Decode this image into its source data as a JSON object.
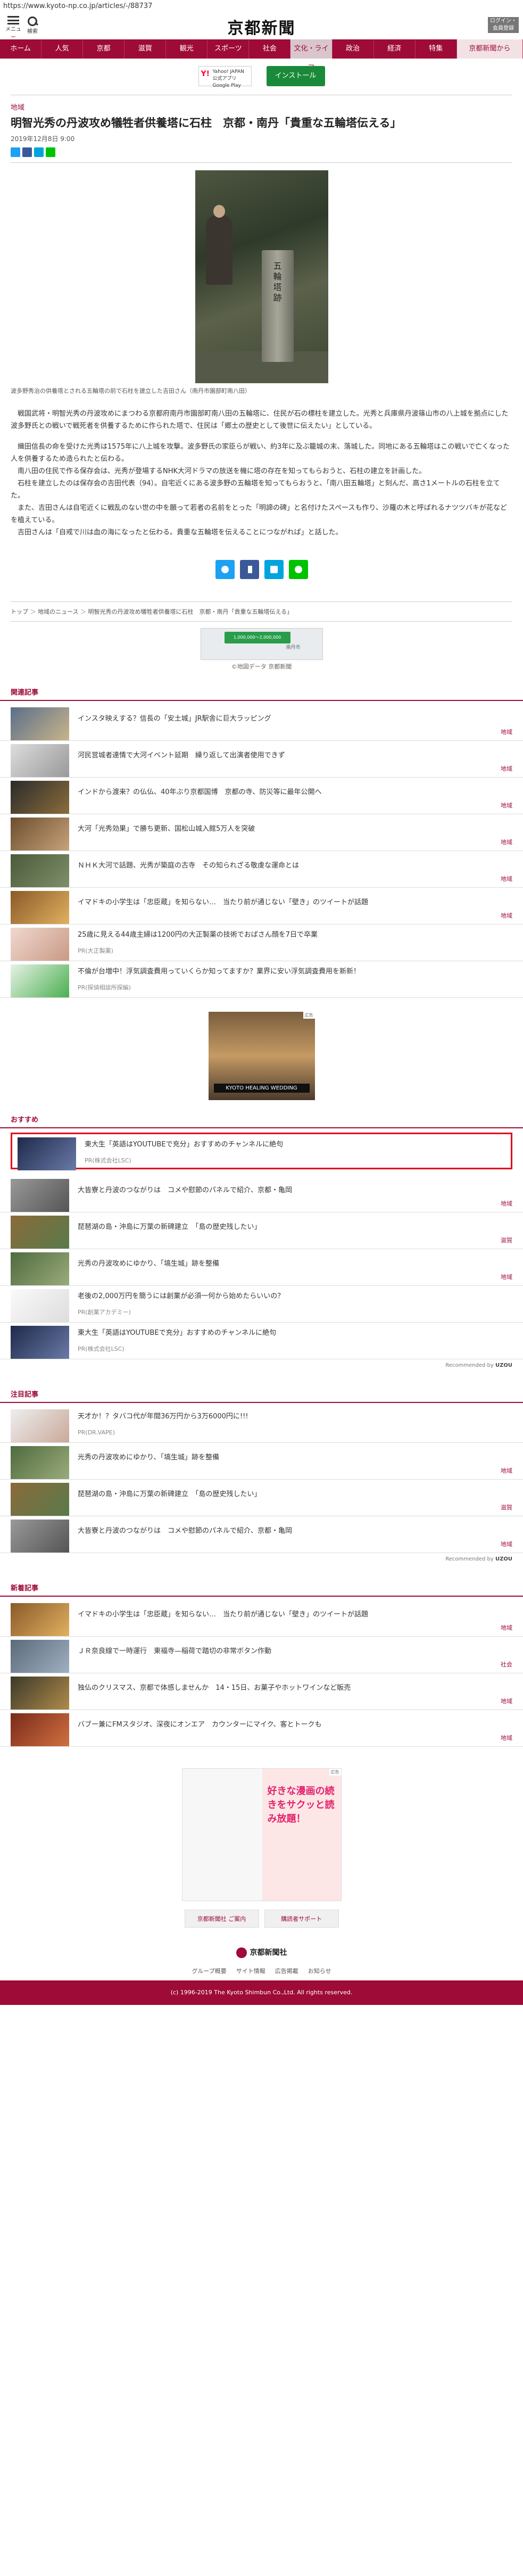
{
  "url": "https://www.kyoto-np.co.jp/articles/-/88737",
  "header": {
    "menu_label": "メニュー",
    "search_label": "検索",
    "logo": "京都新聞",
    "login_label": "ログイン・会員登録"
  },
  "nav": [
    {
      "label": "ホーム"
    },
    {
      "label": "人気"
    },
    {
      "label": "京都"
    },
    {
      "label": "滋賀"
    },
    {
      "label": "観光"
    },
    {
      "label": "スポーツ"
    },
    {
      "label": "社会"
    },
    {
      "label": "文化・ライフ"
    },
    {
      "label": "政治"
    },
    {
      "label": "経済"
    },
    {
      "label": "特集"
    },
    {
      "label": "京都新聞から"
    }
  ],
  "promo": {
    "app_text": "Yahoo! JAPAN 公式アプリ Google Play",
    "install_label": "インストール"
  },
  "article": {
    "kicker": "地域",
    "headline": "明智光秀の丹波攻め犠牲者供養塔に石柱　京都・南丹「貴重な五輪塔伝える」",
    "date": "2019年12月8日 9:00",
    "photo_inscription": "五輪塔跡",
    "caption": "波多野秀治の供養塔とされる五輪塔の前で石柱を建立した吉田さん（南丹市園部町南八田）",
    "paragraphs": [
      "戦国武将・明智光秀の丹波攻めにまつわる京都府南丹市園部町南八田の五輪塔に、住民が石の標柱を建立した。光秀と兵庫県丹波篠山市の八上城を拠点にした波多野氏との戦いで戦死者を供養するために作られた塔で、住民は「郷土の歴史として後世に伝えたい」としている。",
      "織田信長の命を受けた光秀は1575年に八上城を攻撃。波多野氏の家臣らが戦い、約3年に及ぶ籠城の末、落城した。同地にある五輪塔はこの戦いで亡くなった人を供養するため造られたと伝わる。",
      "南八田の住民で作る保存会は、光秀が登場するNHK大河ドラマの放送を機に塔の存在を知ってもらおうと、石柱の建立を計画した。",
      "石柱を建立したのは保存会の吉田代表（94）。自宅近くにある波多野の五輪塔を知ってもらおうと、「南八田五輪塔」と刻んだ、高さ1メートルの石柱を立てた。",
      "また、吉田さんは自宅近くに戦乱のない世の中を願って若者の名前をとった「明諦の碑」と名付けたスペースも作り、沙羅の木と呼ばれるナツツバキが花などを植えている。",
      "吉田さんは「自戒で川は血の海になったと伝わる。貴重な五輪塔を伝えることにつながれば」と話した。"
    ]
  },
  "breadcrumb": [
    "トップ",
    "地域のニュース",
    "明智光秀の丹波攻め犠牲者供養塔に石柱　京都・南丹「貴重な五輪塔伝える」"
  ],
  "map": {
    "box_label": "1,000,000〜2,000,000",
    "pin_label": "南丹市",
    "note": "©地図データ 京都新聞"
  },
  "related": {
    "title": "関連記事",
    "items": [
      {
        "title": "インスタ映えする？信長の「安土城」JR駅舎に巨大ラッピング",
        "category": "地域"
      },
      {
        "title": "河民営城者達情で大河イベント延期　繰り返して出演者使用できず",
        "category": "地域"
      },
      {
        "title": "インドから渡来？の仏仏、40年ぶり京都国博　京都の寺、防災等に最年公開へ",
        "category": "地域"
      },
      {
        "title": "大河「光秀効果」で勝ち更新、国松山城入館5万人を突破",
        "category": "地域"
      },
      {
        "title": "ＮＨＫ大河で話題、光秀が築庭の古寺　その知られざる敬虔な運命とは",
        "category": "地域"
      },
      {
        "title": "イマドキの小学生は「忠臣蔵」を知らない…　当たり前が通じない「壁き」のツイートが話題",
        "category": "地域"
      },
      {
        "title": "25歳に見える44歳主婦は1200円の大正製薬の技術でおばさん顔を7日で卒業",
        "sponsor": "PR(大正製薬)"
      },
      {
        "title": "不倫が台増中！浮気調査費用っていくらか知ってますか？業界に安い浮気調査費用を新新！",
        "sponsor": "PR(探偵相談所探編)"
      }
    ]
  },
  "ad_mid": {
    "tag": "広告",
    "text": "KYOTO HEALING WEDDING"
  },
  "recommend": {
    "title": "おすすめ",
    "featured": {
      "title": "東大生「英語はYOUTUBEで充分」おすすめのチャンネルに絶句",
      "sponsor": "PR(株式会社LSC)"
    },
    "items": [
      {
        "title": "大皆寮と丹波のつながりは　コメや慰節のパネルで紹介、京都・亀岡",
        "category": "地域"
      },
      {
        "title": "琵琶湖の島・沖島に万葉の新碑建立　「島の歴史残したい」",
        "category": "滋賀"
      },
      {
        "title": "光秀の丹波攻めにゆかり、「塙生城」跡を整備",
        "category": "地域"
      },
      {
        "title": "老後の2,000万円を簡うには創業が必須一何から始めたらいいの？",
        "sponsor": "PR(創業アカデミー)"
      },
      {
        "title": "東大生「英語はYOUTUBEで充分」おすすめのチャンネルに絶句",
        "sponsor": "PR(株式会社LSC)"
      }
    ],
    "by_label": "Recommended by",
    "by_brand": "UZOU"
  },
  "notable": {
    "title": "注目記事",
    "items": [
      {
        "title": "天才か！？タバコ代が年間36万円から3万6000円に!!!",
        "sponsor": "PR(DR.VAPE)"
      },
      {
        "title": "光秀の丹波攻めにゆかり、「塙生城」跡を整備",
        "category": "地域"
      },
      {
        "title": "琵琶湖の島・沖島に万葉の新碑建立　「島の歴史残したい」",
        "category": "滋賀"
      },
      {
        "title": "大皆寮と丹波のつながりは　コメや慰節のパネルで紹介、京都・亀岡",
        "category": "地域"
      }
    ],
    "by_label": "Recommended by",
    "by_brand": "UZOU"
  },
  "latest": {
    "title": "新着記事",
    "items": [
      {
        "title": "イマドキの小学生は「忠臣蔵」を知らない…　当たり前が通じない「壁き」のツイートが話題",
        "category": "地域"
      },
      {
        "title": "ＪＲ奈良線で一時運行　東福寺—稲荷で踏切の非常ボタン作動",
        "category": "社会"
      },
      {
        "title": "独仏のクリスマス、京都で体感しませんか　14・15日、お菓子やホットワインなど販売",
        "category": "地域"
      },
      {
        "title": "バブー兼にFMスタジオ、深夜にオンエア　カウンターにマイク、客とトークも",
        "category": "地域"
      }
    ]
  },
  "bottom_ad": {
    "tag": "広告",
    "text": "好きな漫画の続きをサクッと読み放題！"
  },
  "footer": {
    "btn_contact": "京都新聞社 ご案内",
    "btn_support": "購読者サポート",
    "logo": "京都新聞社",
    "links": [
      "グループ概要",
      "サイト情報",
      "広告掲載",
      "お知らせ"
    ],
    "copyright": "(c) 1996-2019 The Kyoto Shimbun Co.,Ltd. All rights reserved."
  },
  "colors": {
    "brand": "#9e0b36",
    "highlight": "#e0001a"
  }
}
